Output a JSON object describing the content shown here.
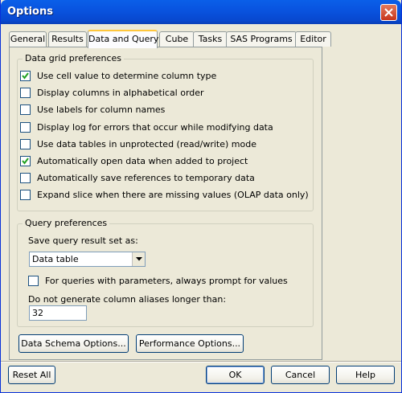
{
  "window": {
    "title": "Options"
  },
  "tabs": [
    {
      "label": "General",
      "active": false
    },
    {
      "label": "Results",
      "active": false
    },
    {
      "label": "Data and Query",
      "active": true
    },
    {
      "label": "Cube",
      "active": false
    },
    {
      "label": "Tasks",
      "active": false
    },
    {
      "label": "SAS Programs",
      "active": false
    },
    {
      "label": "Editor",
      "active": false
    }
  ],
  "data_grid": {
    "legend": "Data grid preferences",
    "options": [
      {
        "label": "Use cell value to determine column type",
        "checked": true
      },
      {
        "label": "Display columns in alphabetical order",
        "checked": false
      },
      {
        "label": "Use labels for column names",
        "checked": false
      },
      {
        "label": "Display log for errors that occur while modifying data",
        "checked": false
      },
      {
        "label": "Use data tables in unprotected (read/write) mode",
        "checked": false
      },
      {
        "label": "Automatically open data when added to project",
        "checked": true
      },
      {
        "label": "Automatically save references to temporary data",
        "checked": false
      },
      {
        "label": "Expand slice when there are missing values (OLAP data only)",
        "checked": false
      }
    ]
  },
  "query": {
    "legend": "Query preferences",
    "save_label": "Save query result set as:",
    "save_value": "Data table",
    "prompt_label": "For queries with parameters, always prompt for values",
    "prompt_checked": false,
    "alias_label": "Do not generate column aliases longer than:",
    "alias_value": "32"
  },
  "buttons": {
    "schema": "Data Schema Options...",
    "performance": "Performance Options...",
    "reset": "Reset All",
    "ok": "OK",
    "cancel": "Cancel",
    "help": "Help"
  }
}
